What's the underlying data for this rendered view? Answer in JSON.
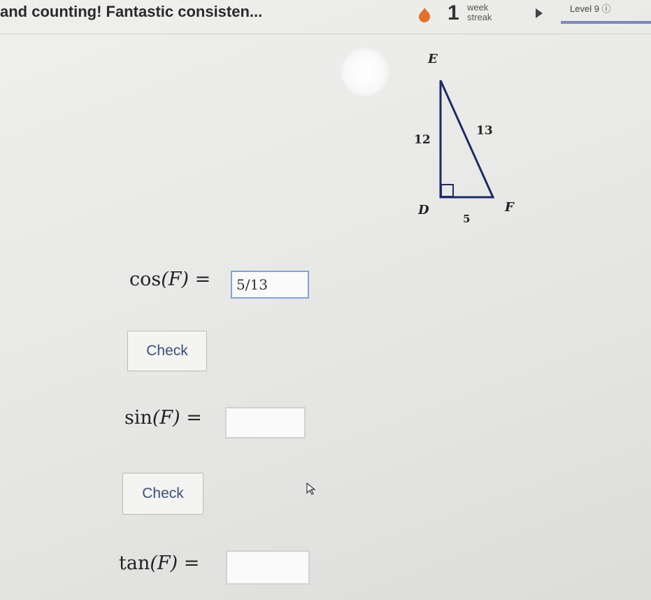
{
  "header": {
    "message": "and counting! Fantastic consisten...",
    "streak_count": "1",
    "streak_unit_line1": "week",
    "streak_unit_line2": "streak",
    "level_label": "Level 9 ⓘ"
  },
  "diagram": {
    "vertex_top": "E",
    "vertex_bottom_left": "D",
    "vertex_bottom_right": "F",
    "side_ed": "12",
    "side_ef": "13",
    "side_df": "5"
  },
  "problems": [
    {
      "function": "cos",
      "prompt_func": "cos",
      "prompt_arg": "(F) =",
      "answer_value": "5/13",
      "check_label": "Check"
    },
    {
      "function": "sin",
      "prompt_func": "sin",
      "prompt_arg": "(F) =",
      "answer_value": "",
      "check_label": "Check"
    },
    {
      "function": "tan",
      "prompt_func": "tan",
      "prompt_arg": "(F) =",
      "answer_value": ""
    }
  ],
  "colors": {
    "level_bar": "#7a8ab8",
    "active_input_border": "#7fa3d6",
    "check_text": "#3a4f7a"
  }
}
